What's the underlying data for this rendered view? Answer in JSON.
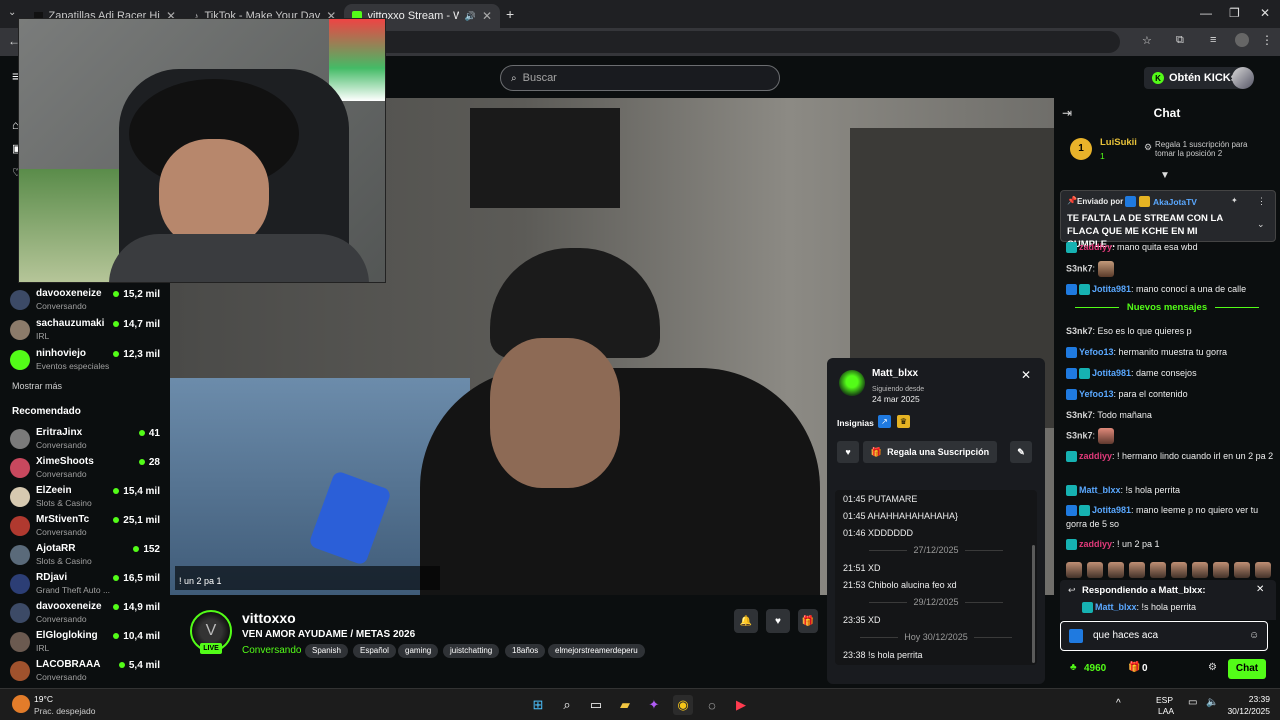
{
  "browser": {
    "tabs": [
      {
        "label": "Zapatillas Adi Racer Hi - Azul a"
      },
      {
        "label": "TikTok - Make Your Day"
      },
      {
        "label": "vittoxxo Stream - Watch Li"
      }
    ]
  },
  "header": {
    "search_placeholder": "Buscar",
    "kicks_button": "Obtén KICKs"
  },
  "sidebar": {
    "following": [
      {
        "name": "davooxeneize",
        "category": "Conversando",
        "viewers": "15,2 mil"
      },
      {
        "name": "sachauzumaki",
        "category": "IRL",
        "viewers": "14,7 mil"
      },
      {
        "name": "ninhoviejo",
        "category": "Eventos especiales",
        "viewers": "12,3 mil"
      }
    ],
    "show_more": "Mostrar más",
    "recommended_title": "Recomendado",
    "recommended": [
      {
        "name": "EritraJinx",
        "category": "Conversando",
        "viewers": "41"
      },
      {
        "name": "XimeShoots",
        "category": "Conversando",
        "viewers": "28"
      },
      {
        "name": "ElZeein",
        "category": "Slots & Casino",
        "viewers": "15,4 mil"
      },
      {
        "name": "MrStivenTc",
        "category": "Conversando",
        "viewers": "25,1 mil"
      },
      {
        "name": "AjotaRR",
        "category": "Slots & Casino",
        "viewers": "152"
      },
      {
        "name": "RDjavi",
        "category": "Grand Theft Auto ...",
        "viewers": "16,5 mil"
      },
      {
        "name": "davooxeneize",
        "category": "Conversando",
        "viewers": "14,9 mil"
      },
      {
        "name": "ElGlogloking",
        "category": "IRL",
        "viewers": "10,4 mil"
      },
      {
        "name": "LACOBRAAA",
        "category": "Conversando",
        "viewers": "5,4 mil"
      }
    ]
  },
  "video": {
    "overlay_chat": "! un 2 pa 1"
  },
  "stream": {
    "streamer": "vittoxxo",
    "live_label": "LIVE",
    "title": "VEN AMOR AYUDAME / METAS 2026",
    "category": "Conversando",
    "tags": [
      "Spanish",
      "Español",
      "gaming",
      "juistchatting",
      "18años",
      "elmejorstreamerdeperu"
    ]
  },
  "user_popup": {
    "username": "Matt_blxx",
    "following_label": "Siguiendo desde",
    "following_date": "24 mar 2025",
    "badges_label": "Insignias",
    "gift_button": "Regala una Suscripción",
    "history": [
      {
        "kind": "msg",
        "text": "01:45 PUTAMARE"
      },
      {
        "kind": "msg",
        "text": "01:45 AHAHHAHAHAHAHA}"
      },
      {
        "kind": "msg",
        "text": "01:46 XDDDDDD"
      },
      {
        "kind": "date",
        "text": "27/12/2025"
      },
      {
        "kind": "msg",
        "text": "21:51 XD"
      },
      {
        "kind": "msg",
        "text": "21:53 Chibolo alucina feo xd"
      },
      {
        "kind": "date",
        "text": "29/12/2025"
      },
      {
        "kind": "msg",
        "text": "23:35 XD"
      },
      {
        "kind": "date",
        "text": "Hoy 30/12/2025"
      },
      {
        "kind": "msg",
        "text": "23:38 !s hola perrita"
      }
    ]
  },
  "chat": {
    "title": "Chat",
    "top_gifter": {
      "name": "LuiSukii",
      "count": "1",
      "rank": "1",
      "cta": "Regala 1 suscripción para tomar la posición 2"
    },
    "pinned": {
      "sent_by": "Enviado por",
      "user": "AkaJotaTV",
      "text": "TE FALTA LA DE STREAM CON LA FLACA QUE ME KCHE EN MI CUMPLE..."
    },
    "new_messages": "Nuevos mensajes",
    "messages": [
      {
        "user": "zaddiyy",
        "text": ": mano quita esa wbd"
      },
      {
        "user": "S3nk7",
        "text": ":"
      },
      {
        "user": "Jotita981",
        "text": ": mano conocí a una de calle"
      },
      {
        "user": "S3nk7",
        "text": ": Eso es lo que quieres p"
      },
      {
        "user": "Yefoo13",
        "text": ": hermanito muestra tu gorra"
      },
      {
        "user": "Jotita981",
        "text": ": dame consejos"
      },
      {
        "user": "Yefoo13",
        "text": ": para el contenido"
      },
      {
        "user": "S3nk7",
        "text": ": Todo mañana"
      },
      {
        "user": "S3nk7",
        "text": ":"
      },
      {
        "user": "zaddiyy",
        "text": ": ! hermano lindo cuando irl en un 2 pa 2"
      },
      {
        "user": "Matt_blxx",
        "text": ": !s hola perrita"
      },
      {
        "user": "Jotita981",
        "text": ": mano leeme p no quiero ver tu gorra de 5 so"
      },
      {
        "user": "zaddiyy",
        "text": ": ! un 2 pa 1"
      }
    ],
    "reply_label": "Respondiendo a Matt_blxx:",
    "reply_user": "Matt_blxx",
    "reply_text": ": !s hola perrita",
    "input_value": "que haces aca",
    "kicks_balance": "4960",
    "gift_count": "0",
    "send_button": "Chat"
  },
  "taskbar": {
    "weather_temp": "19°C",
    "weather_desc": "Prac. despejado",
    "lang_top": "ESP",
    "lang_bottom": "LAA",
    "time": "23:39",
    "date": "30/12/2025"
  },
  "colors": {
    "accent": "#53fc18",
    "bg": "#0b0e0f",
    "panel": "#191b1f"
  }
}
